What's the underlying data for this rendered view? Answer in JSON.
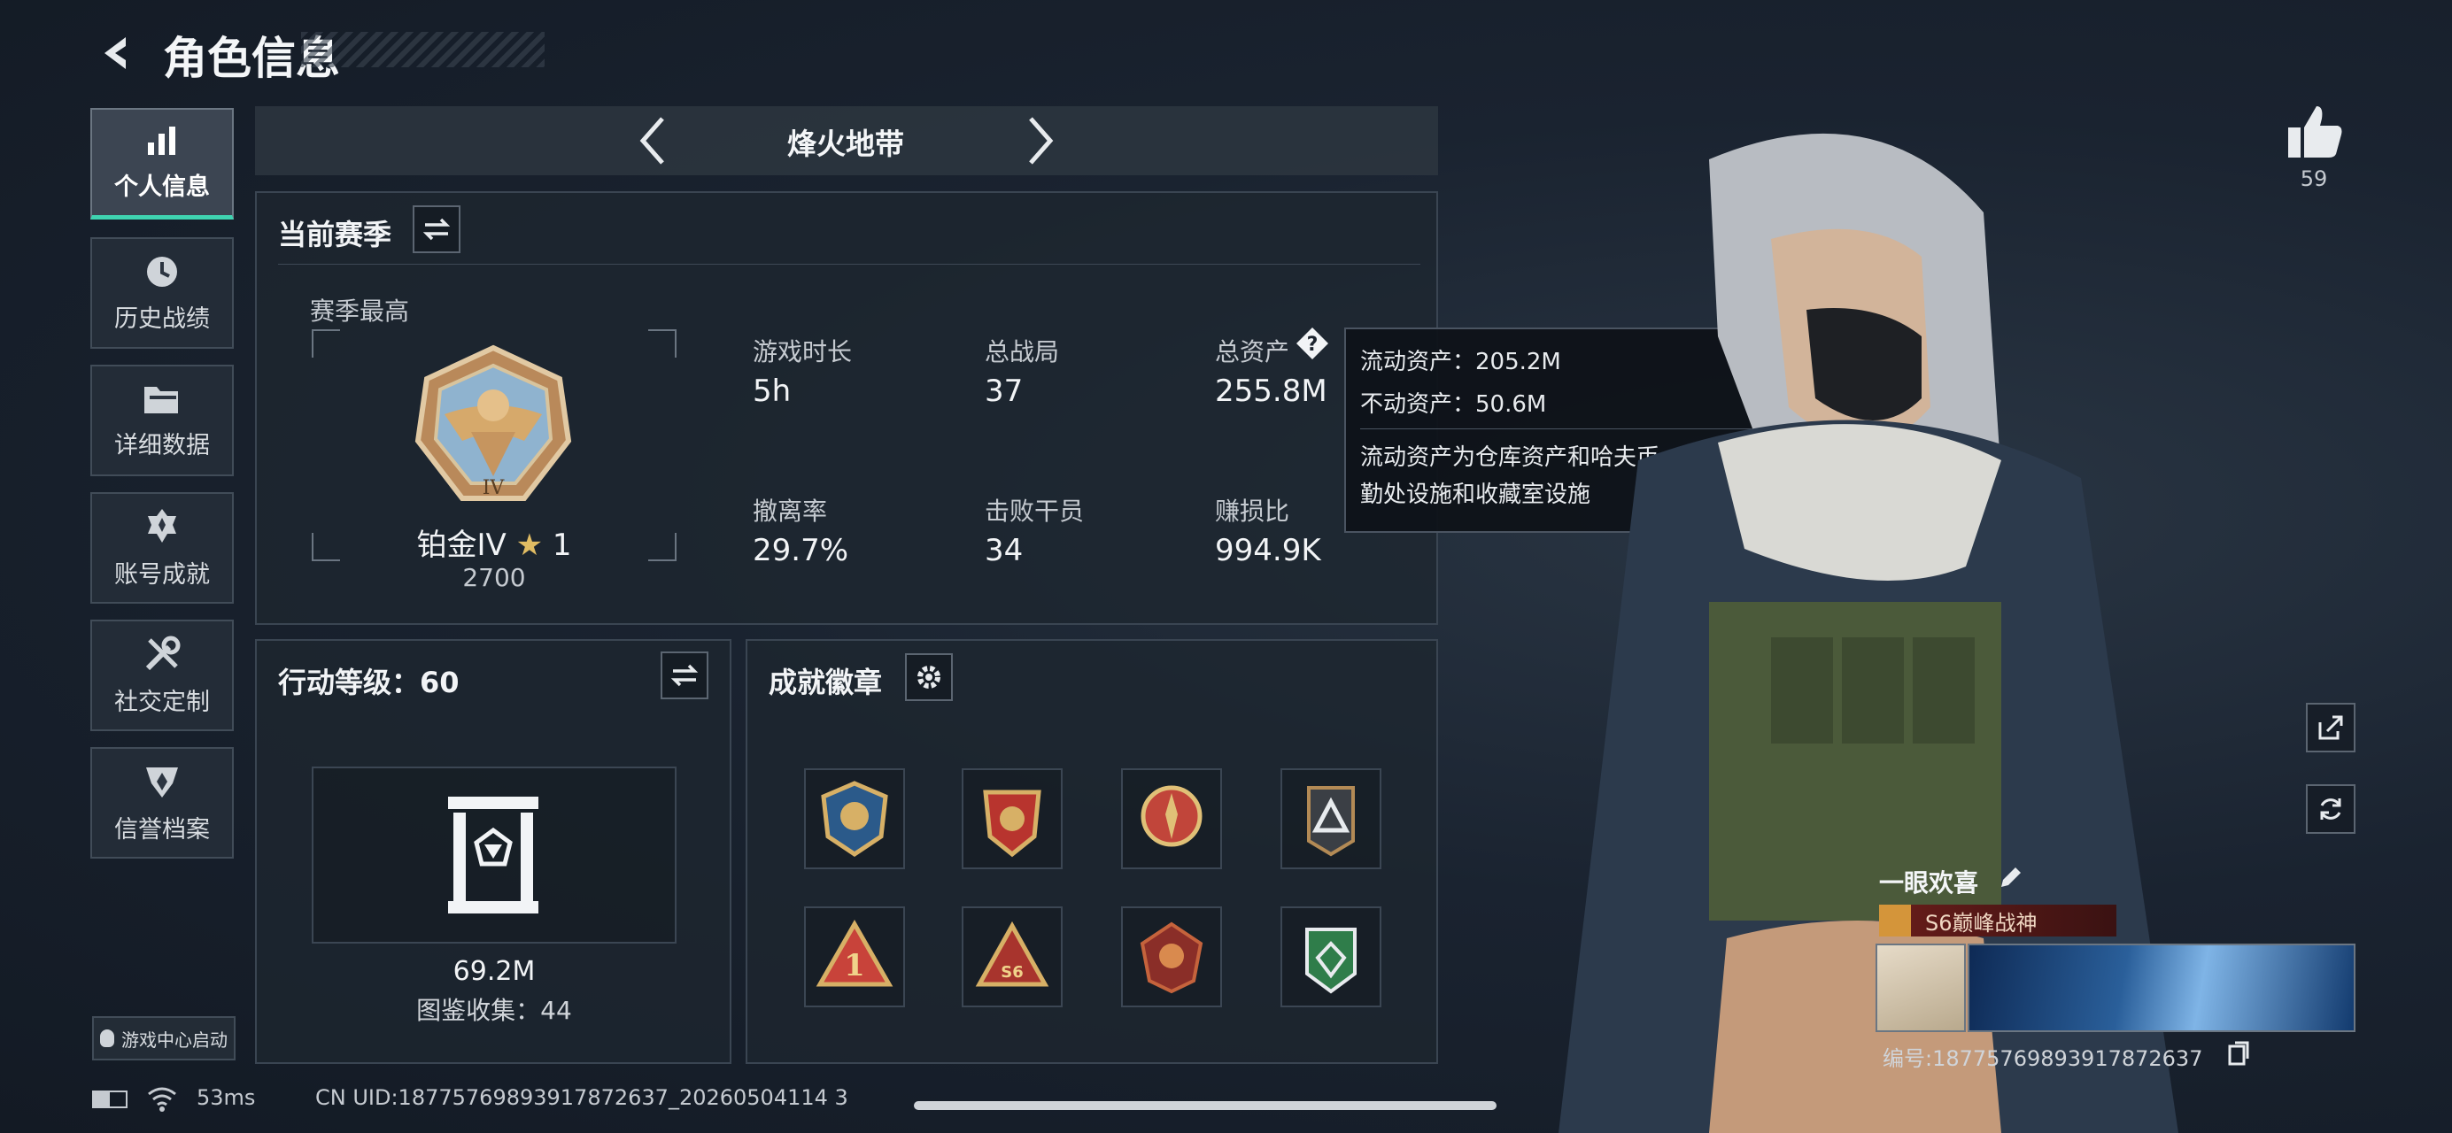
{
  "header": {
    "title": "角色信息"
  },
  "sidebar": {
    "items": [
      {
        "label": "个人信息",
        "icon": "bar-chart-icon",
        "active": true
      },
      {
        "label": "历史战绩",
        "icon": "clock-icon"
      },
      {
        "label": "详细数据",
        "icon": "folder-icon"
      },
      {
        "label": "账号成就",
        "icon": "medal-icon"
      },
      {
        "label": "社交定制",
        "icon": "tools-icon"
      },
      {
        "label": "信誉档案",
        "icon": "shield-icon"
      }
    ],
    "game_center": "游戏中心启动"
  },
  "mode_selector": {
    "label": "烽火地带"
  },
  "season": {
    "title": "当前赛季",
    "highest_label": "赛季最高",
    "rank_name": "铂金IV",
    "rank_stars": "1",
    "rank_score": "2700",
    "stats": [
      {
        "label": "游戏时长",
        "value": "5h"
      },
      {
        "label": "总战局",
        "value": "37"
      },
      {
        "label": "总资产",
        "value": "255.8M"
      },
      {
        "label": "撤离率",
        "value": "29.7%"
      },
      {
        "label": "击败干员",
        "value": "34"
      },
      {
        "label": "赚损比",
        "value": "994.9K"
      }
    ]
  },
  "tooltip": {
    "liquid": "流动资产：205.2M",
    "fixed": "不动资产：50.6M",
    "desc": "流动资产为仓库资产和哈夫币，不动资产为特勤处设施和收藏室设施"
  },
  "level": {
    "title": "行动等级：60",
    "value": "69.2M",
    "collection": "图鉴收集：44"
  },
  "badges": {
    "title": "成就徽章",
    "items": [
      "badge-1",
      "badge-2",
      "badge-3",
      "badge-4",
      "badge-5",
      "badge-6",
      "badge-7",
      "badge-8"
    ]
  },
  "player": {
    "likes": "59",
    "name": "一眼欢喜",
    "title": "S6巅峰战神",
    "id": "编号:18775769893917872637"
  },
  "status": {
    "ping": "53ms",
    "uid": "CN UID:18775769893917872637_20260504114 3"
  }
}
